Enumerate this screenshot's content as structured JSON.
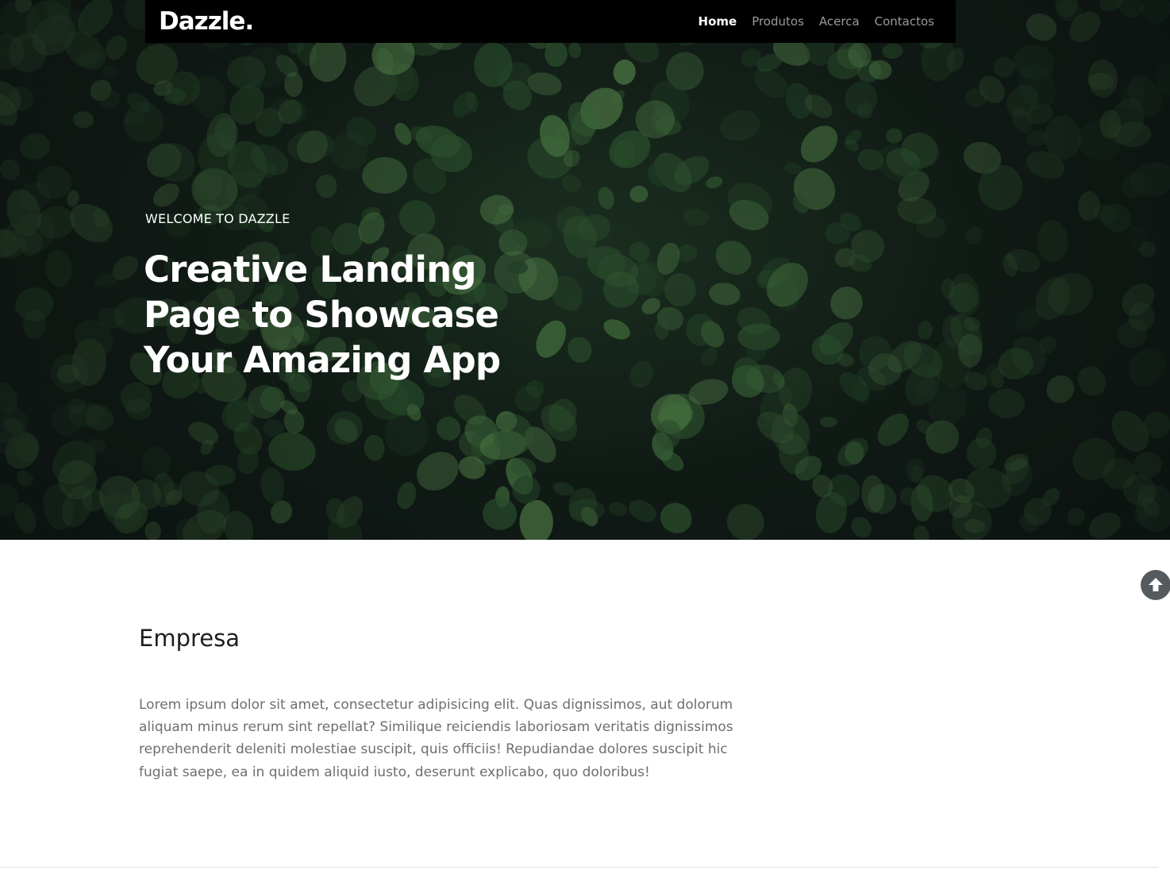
{
  "brand": {
    "name": "Dazzle."
  },
  "nav": {
    "items": [
      {
        "label": "Home",
        "active": true
      },
      {
        "label": "Produtos",
        "active": false
      },
      {
        "label": "Acerca",
        "active": false
      },
      {
        "label": "Contactos",
        "active": false
      }
    ]
  },
  "hero": {
    "eyebrow": "WELCOME TO DAZZLE",
    "headline_lines": [
      "Creative Landing",
      "Page to Showcase",
      "Your Amazing App"
    ]
  },
  "scroll_top": {
    "icon": "arrow-up-circle-icon",
    "color": "#555a5e"
  },
  "section": {
    "title": "Empresa",
    "text": "Lorem ipsum dolor sit amet, consectetur adipisicing elit. Quas dignissimos, aut dolorum aliquam minus rerum sint repellat? Similique reiciendis laboriosam veritatis dignissimos reprehenderit deleniti molestiae suscipit, quis officiis! Repudiandae dolores suscipit hic fugiat saepe, ea in quidem aliquid iusto, deserunt explicabo, quo doloribus!"
  },
  "colors": {
    "navbar_bg": "#000000",
    "nav_active": "#ffffff",
    "nav_inactive": "#9a9a9a",
    "hero_foliage": "#3f6b3c",
    "body_text": "#6e6e6e"
  }
}
